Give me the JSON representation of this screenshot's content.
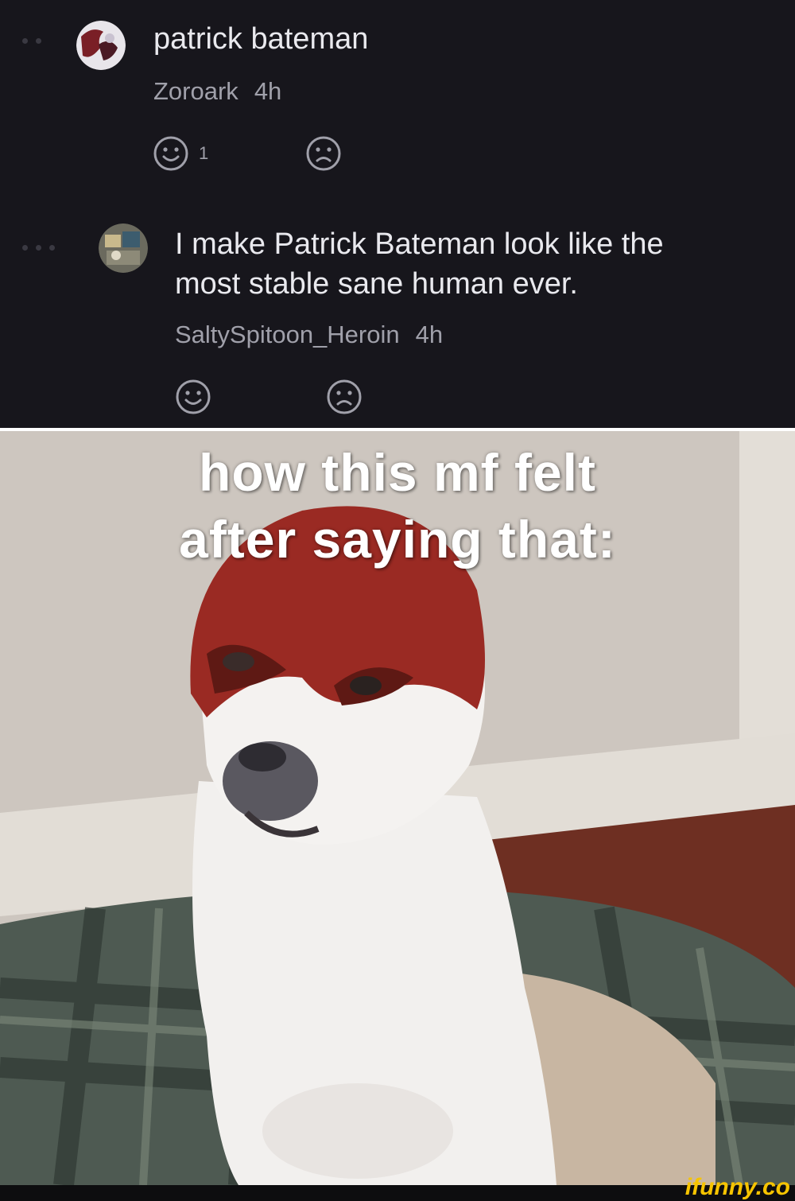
{
  "comments": [
    {
      "text": "patrick bateman",
      "username": "Zoroark",
      "time": "4h",
      "likes": "1",
      "like_icon": "smile-icon",
      "dislike_icon": "frown-icon"
    },
    {
      "text_line1": "I make Patrick Bateman look like the",
      "text_line2": "most stable sane human ever.",
      "username": "SaltySpitoon_Heroin",
      "time": "4h",
      "like_icon": "smile-icon",
      "dislike_icon": "frown-icon"
    }
  ],
  "meme": {
    "caption_line1": "how this mf felt",
    "caption_line2": "after saying that:"
  },
  "watermark": "ifunny.co",
  "colors": {
    "background": "#17161c",
    "text": "#e9e9ee",
    "muted": "#a0a0aa",
    "brand": "#f6c400",
    "mask": "#9a2a23"
  }
}
